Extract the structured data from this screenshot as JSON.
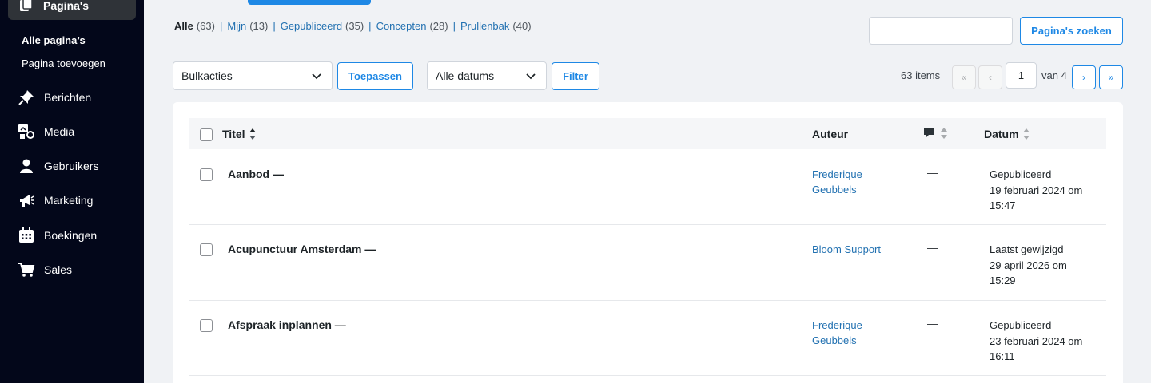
{
  "sidebar": {
    "current": {
      "label": "Pagina's",
      "icon": "pages-icon"
    },
    "submenu": [
      {
        "label": "Alle pagina’s",
        "active": true
      },
      {
        "label": "Pagina toevoegen",
        "active": false
      }
    ],
    "items": [
      {
        "label": "Berichten",
        "icon": "pin-icon"
      },
      {
        "label": "Media",
        "icon": "media-icon"
      },
      {
        "label": "Gebruikers",
        "icon": "user-icon"
      },
      {
        "label": "Marketing",
        "icon": "megaphone-icon"
      },
      {
        "label": "Boekingen",
        "icon": "calendar-icon"
      },
      {
        "label": "Sales",
        "icon": "cart-icon"
      }
    ]
  },
  "filters": {
    "all": {
      "label": "Alle",
      "count": "(63)"
    },
    "mine": {
      "label": "Mijn",
      "count": "(13)"
    },
    "published": {
      "label": "Gepubliceerd",
      "count": "(35)"
    },
    "drafts": {
      "label": "Concepten",
      "count": "(28)"
    },
    "trash": {
      "label": "Prullenbak",
      "count": "(40)"
    },
    "separator": "|"
  },
  "search": {
    "value": "",
    "button": "Pagina's zoeken"
  },
  "toolbar": {
    "bulk_select": "Bulkacties",
    "apply": "Toepassen",
    "date_select": "Alle datums",
    "filter": "Filter"
  },
  "pagination": {
    "items": "63 items",
    "first": "«",
    "prev": "‹",
    "current": "1",
    "of": "van 4",
    "next": "›",
    "last": "»"
  },
  "table": {
    "headers": {
      "title": "Titel",
      "author": "Auteur",
      "date": "Datum"
    },
    "rows": [
      {
        "title": "Aanbod —",
        "author_line1": "Frederique",
        "author_line2": "Geubbels",
        "comments": "—",
        "date_line1": "Gepubliceerd",
        "date_line2": "19 februari 2024 om",
        "date_line3": "15:47"
      },
      {
        "title": "Acupunctuur Amsterdam —",
        "author_line1": "Bloom Support",
        "author_line2": "",
        "comments": "—",
        "date_line1": "Laatst gewijzigd",
        "date_line2": "29 april 2026 om",
        "date_line3": "15:29"
      },
      {
        "title": "Afspraak inplannen —",
        "author_line1": "Frederique",
        "author_line2": "Geubbels",
        "comments": "—",
        "date_line1": "Gepubliceerd",
        "date_line2": "23 februari 2024 om",
        "date_line3": "16:11"
      }
    ]
  },
  "colors": {
    "accent": "#1e88e5",
    "link": "#2271b1",
    "sidebar": "#03071a"
  }
}
